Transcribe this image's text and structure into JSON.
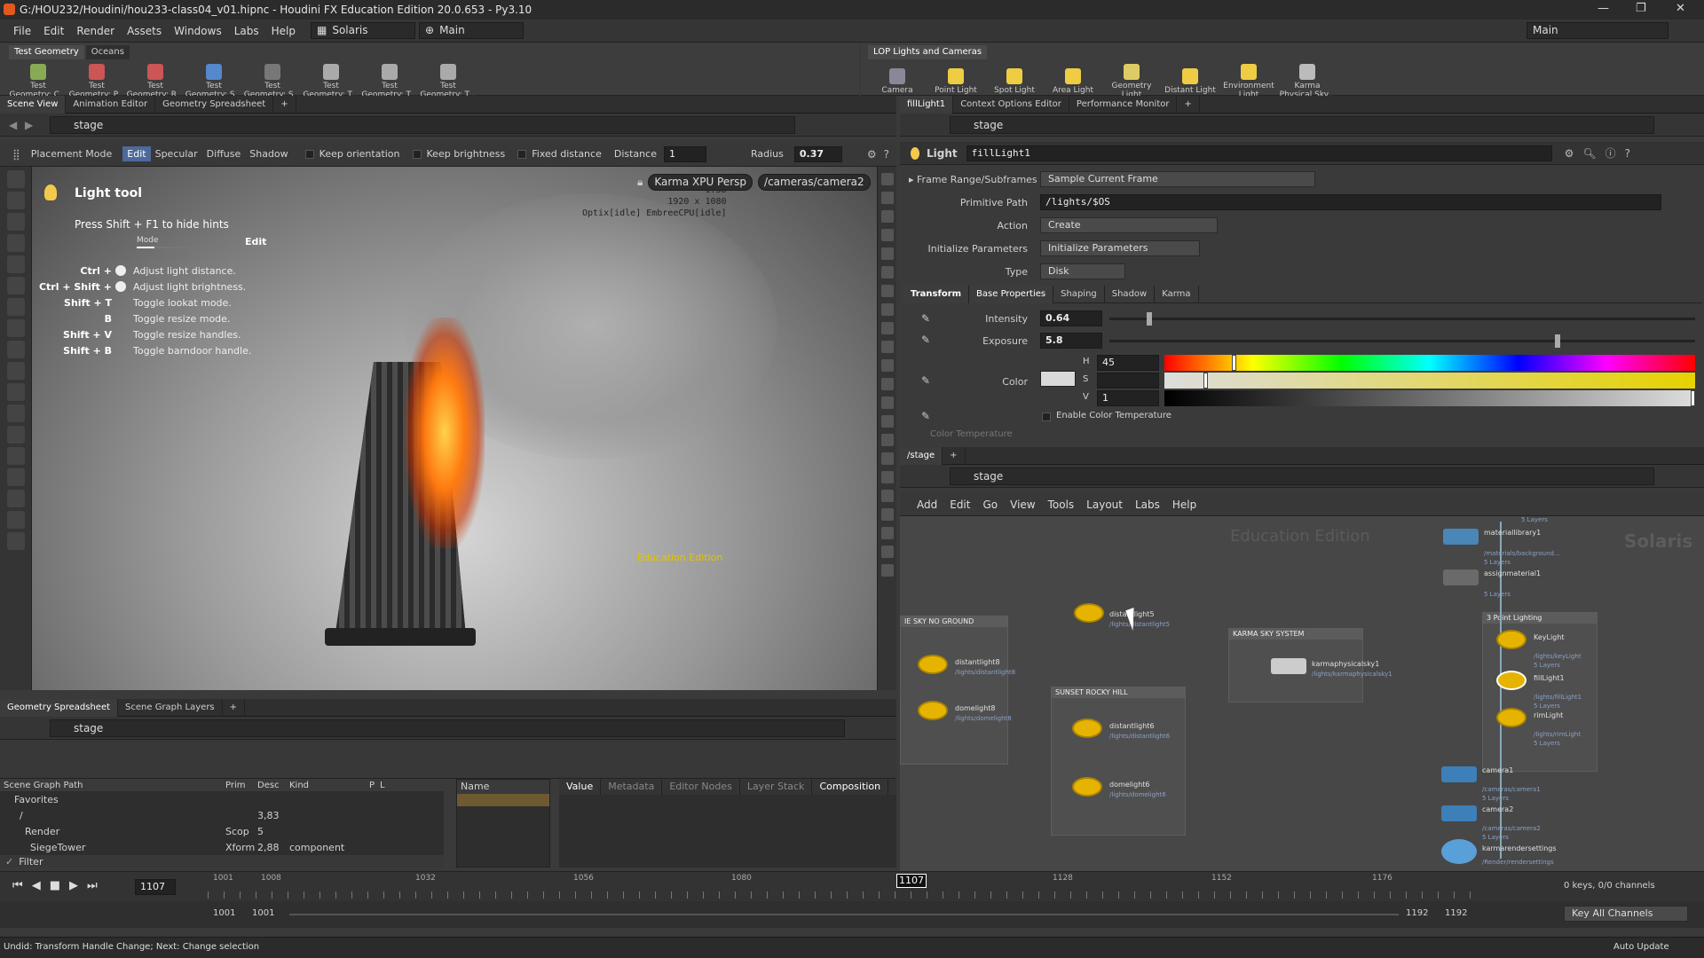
{
  "window": {
    "title": "G:/HOU232/Houdini/hou233-class04_v01.hipnc - Houdini FX Education Edition 20.0.653 - Py3.10"
  },
  "menubar": {
    "items": [
      "File",
      "Edit",
      "Render",
      "Assets",
      "Windows",
      "Labs",
      "Help"
    ],
    "desktop": "Solaris",
    "context": "Main",
    "right_context": "Main"
  },
  "shelf_left": {
    "tabs": [
      "Test Geometry",
      "Oceans"
    ],
    "tools": [
      "Test Geometry: C...",
      "Test Geometry: P...",
      "Test Geometry: R...",
      "Test Geometry: S...",
      "Test Geometry: S...",
      "Test Geometry: T...",
      "Test Geometry: T...",
      "Test Geometry: T..."
    ]
  },
  "shelf_right": {
    "tabs": [
      "LOP Lights and Cameras"
    ],
    "tools": [
      "Camera",
      "Point Light",
      "Spot Light",
      "Area Light",
      "Geometry Light",
      "Distant Light",
      "Environment Light",
      "Karma Physical Sky..."
    ]
  },
  "viewer": {
    "tabs": [
      "Scene View",
      "Animation Editor",
      "Geometry Spreadsheet"
    ],
    "path": "stage",
    "toolbar": {
      "placement": "Placement Mode",
      "modes": [
        "Edit",
        "Specular",
        "Diffuse",
        "Shadow"
      ],
      "keep_orientation": "Keep orientation",
      "keep_brightness": "Keep brightness",
      "fixed_distance": "Fixed distance",
      "distance_label": "Distance",
      "distance_value": "1",
      "radius_label": "Radius",
      "radius_value": "0.37"
    },
    "renderer": "Karma XPU Persp",
    "camera": "/cameras/camera2",
    "info": [
      "1:38",
      "1920 x 1080",
      "Optix[idle] EmbreeCPU[idle]"
    ],
    "hud_title": "Light tool",
    "hud_press": "Press Shift + F1 to hide hints",
    "hud_mode": "Mode",
    "hud_edit": "Edit",
    "hints": [
      {
        "k": "Ctrl +",
        "t": "Adjust light distance."
      },
      {
        "k": "Ctrl + Shift +",
        "t": "Adjust light brightness."
      },
      {
        "k": "Shift + T",
        "t": "Toggle lookat mode."
      },
      {
        "k": "B",
        "t": "Toggle resize mode."
      },
      {
        "k": "Shift + V",
        "t": "Toggle resize handles."
      },
      {
        "k": "Shift + B",
        "t": "Toggle barndoor handle."
      }
    ],
    "watermark": "Education Edition"
  },
  "params": {
    "tabs": [
      "fillLight1",
      "Context Options Editor",
      "Performance Monitor"
    ],
    "path": "stage",
    "node_type": "Light",
    "node_name": "fillLight1",
    "frame_range_label": "Frame Range/Subframes",
    "frame_range_value": "Sample Current Frame",
    "prim_path_label": "Primitive Path",
    "prim_path_value": "/lights/$OS",
    "action_label": "Action",
    "action_value": "Create",
    "init_label": "Initialize Parameters",
    "init_value": "Initialize Parameters",
    "type_label": "Type",
    "type_value": "Disk",
    "subtabs": [
      "Transform",
      "Base Properties",
      "Shaping",
      "Shadow",
      "Karma"
    ],
    "intensity_label": "Intensity",
    "intensity_value": "0.64",
    "intensity_level": 0.064,
    "exposure_label": "Exposure",
    "exposure_value": "5.8",
    "color_label": "Color",
    "h_label": "H",
    "h_value": "45",
    "s_label": "S",
    "s_value": "",
    "v_label": "V",
    "v_value": "1",
    "enable_temp": "Enable Color Temperature",
    "color_temp": "Color Temperature"
  },
  "network": {
    "tabs": [
      "/stage"
    ],
    "path": "stage",
    "menu": [
      "Add",
      "Edit",
      "Go",
      "View",
      "Tools",
      "Layout",
      "Labs",
      "Help"
    ],
    "watermark": "Education Edition",
    "context_label": "Solaris",
    "boxes": {
      "sky_no_ground": "IE SKY NO GROUND",
      "sunset": "SUNSET ROCKY HILL",
      "karma_sky": "KARMA SKY SYSTEM",
      "three_point": "3 Point Lighting"
    },
    "nodes": {
      "distantlight5": {
        "name": "distantlight5",
        "path": "/lights/distantlight5"
      },
      "distantlight8": {
        "name": "distantlight8",
        "path": "/lights/distantlight8"
      },
      "domelight8": {
        "name": "domelight8",
        "path": "/lights/domelight8"
      },
      "distantlight6": {
        "name": "distantlight6",
        "path": "/lights/distantlight6"
      },
      "domelight6": {
        "name": "domelight6",
        "path": "/lights/domelight6"
      },
      "karmaphysicalsky1": {
        "name": "karmaphysicalsky1",
        "path": "/lights/karmaphysicalsky1"
      },
      "materiallibrary1": {
        "name": "materiallibrary1",
        "path": "/materials/background...",
        "layers": "5 Layers"
      },
      "assignmaterial1": {
        "name": "assignmaterial1",
        "layers": "5 Layers"
      },
      "keyLight": {
        "name": "KeyLight",
        "path": "/lights/keyLight",
        "layers": "5 Layers"
      },
      "fillLight": {
        "name": "fillLight1",
        "path": "/lights/fillLight1",
        "layers": "5 Layers"
      },
      "rimLight": {
        "name": "rimLight",
        "path": "/lights/rimLight",
        "layers": "5 Layers"
      },
      "camera1": {
        "name": "camera1",
        "path": "/cameras/camera1",
        "layers": "5 Layers"
      },
      "camera2": {
        "name": "camera2",
        "path": "/cameras/camera2",
        "layers": "5 Layers"
      },
      "karmarendersettings": {
        "name": "karmarendersettings",
        "path": "/Render/rendersettings"
      },
      "top_layers": "5 Layers"
    }
  },
  "scenegraph": {
    "tabs": [
      "Geometry Spreadsheet",
      "Scene Graph Layers"
    ],
    "path": "stage",
    "cols": [
      "Scene Graph Path",
      "Prim",
      "Desc",
      "Kind",
      "P",
      "L"
    ],
    "rows": [
      {
        "name": "Favorites",
        "prim": "",
        "desc": "",
        "kind": ""
      },
      {
        "name": "/",
        "prim": "",
        "desc": "3,83",
        "kind": ""
      },
      {
        "name": "Render",
        "prim": "Scop",
        "desc": "5",
        "kind": ""
      },
      {
        "name": "SiegeTower",
        "prim": "Xform",
        "desc": "2,88",
        "kind": "component"
      }
    ],
    "filter": "Filter",
    "name_col": "Name",
    "detail_tabs": [
      "Value",
      "Metadata",
      "Editor Nodes",
      "Layer Stack",
      "Composition"
    ],
    "edu": "Education"
  },
  "timeline": {
    "frame": "1107",
    "ticks": [
      "1001",
      "1008",
      "1032",
      "1056",
      "1080",
      "1107",
      "1128",
      "1152",
      "1176"
    ],
    "start": "1001",
    "start2": "1001",
    "end": "1192",
    "end2": "1192",
    "keys": "0 keys, 0/0 channels",
    "key_all": "Key All Channels",
    "auto_update": "Auto Update"
  },
  "status": {
    "text": "Undid: Transform Handle Change; Next: Change selection"
  }
}
